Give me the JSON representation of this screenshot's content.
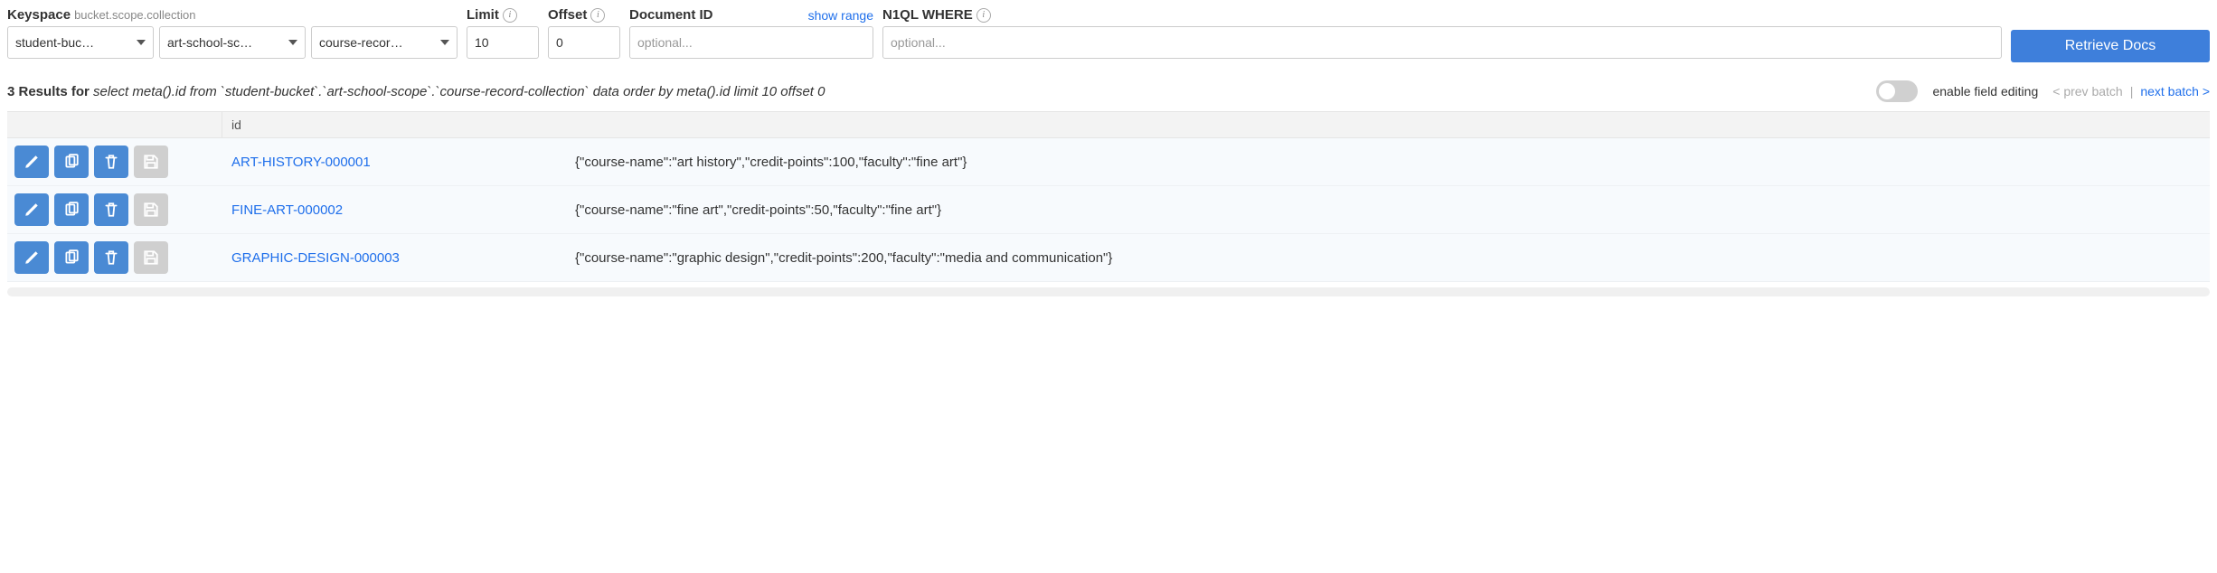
{
  "filters": {
    "keyspace": {
      "label": "Keyspace",
      "sublabel": "bucket.scope.collection",
      "bucket": "student-buc…",
      "scope": "art-school-sc…",
      "collection": "course-recor…"
    },
    "limit": {
      "label": "Limit",
      "value": "10"
    },
    "offset": {
      "label": "Offset",
      "value": "0"
    },
    "document_id": {
      "label": "Document ID",
      "placeholder": "optional...",
      "show_range": "show range"
    },
    "n1ql_where": {
      "label": "N1QL WHERE",
      "placeholder": "optional..."
    },
    "retrieve_button": "Retrieve Docs"
  },
  "results": {
    "count_prefix": "3 Results for",
    "query": "select meta().id from `student-bucket`.`art-school-scope`.`course-record-collection` data order by meta().id limit 10 offset 0",
    "enable_field_editing": "enable field editing",
    "prev_batch": "< prev batch",
    "separator": "|",
    "next_batch": "next batch >"
  },
  "table": {
    "id_header": "id",
    "rows": [
      {
        "id": "ART-HISTORY-000001",
        "content": "{\"course-name\":\"art history\",\"credit-points\":100,\"faculty\":\"fine art\"}"
      },
      {
        "id": "FINE-ART-000002",
        "content": "{\"course-name\":\"fine art\",\"credit-points\":50,\"faculty\":\"fine art\"}"
      },
      {
        "id": "GRAPHIC-DESIGN-000003",
        "content": "{\"course-name\":\"graphic design\",\"credit-points\":200,\"faculty\":\"media and communication\"}"
      }
    ]
  }
}
